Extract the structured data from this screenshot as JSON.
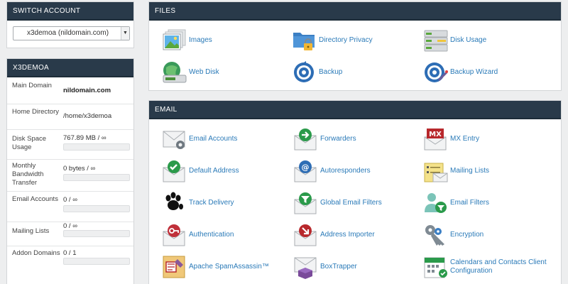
{
  "switch_account": {
    "title": "SWITCH ACCOUNT",
    "selected": "x3demoa (nildomain.com)"
  },
  "account": {
    "title": "X3DEMOA",
    "stats": [
      {
        "label": "Main Domain",
        "value": "nildomain.com"
      },
      {
        "label": "Home Directory",
        "value": "/home/x3demoa"
      },
      {
        "label": "Disk Space Usage",
        "value": "767.89 MB / ∞",
        "usage": 0
      },
      {
        "label": "Monthly Bandwidth Transfer",
        "value": "0 bytes / ∞",
        "usage": 0
      },
      {
        "label": "Email Accounts",
        "value": "0 / ∞",
        "usage": 0
      },
      {
        "label": "Mailing Lists",
        "value": "0 / ∞",
        "usage": 0
      },
      {
        "label": "Addon Domains",
        "value": "0 / 1",
        "usage": 0
      }
    ]
  },
  "files": {
    "title": "FILES",
    "items": [
      {
        "label": "Images",
        "icon": "images-icon"
      },
      {
        "label": "Directory Privacy",
        "icon": "folder-lock-icon"
      },
      {
        "label": "Disk Usage",
        "icon": "disk-usage-icon"
      },
      {
        "label": "Web Disk",
        "icon": "web-disk-icon"
      },
      {
        "label": "Backup",
        "icon": "backup-icon"
      },
      {
        "label": "Backup Wizard",
        "icon": "backup-wizard-icon"
      }
    ]
  },
  "email": {
    "title": "EMAIL",
    "items": [
      {
        "label": "Email Accounts",
        "icon": "email-accounts-icon"
      },
      {
        "label": "Forwarders",
        "icon": "forwarders-icon"
      },
      {
        "label": "MX Entry",
        "icon": "mx-entry-icon"
      },
      {
        "label": "Default Address",
        "icon": "default-address-icon"
      },
      {
        "label": "Autoresponders",
        "icon": "autoresponders-icon"
      },
      {
        "label": "Mailing Lists",
        "icon": "mailing-lists-icon"
      },
      {
        "label": "Track Delivery",
        "icon": "track-delivery-icon"
      },
      {
        "label": "Global Email Filters",
        "icon": "global-filters-icon"
      },
      {
        "label": "Email Filters",
        "icon": "email-filters-icon"
      },
      {
        "label": "Authentication",
        "icon": "authentication-icon"
      },
      {
        "label": "Address Importer",
        "icon": "address-importer-icon"
      },
      {
        "label": "Encryption",
        "icon": "encryption-icon"
      },
      {
        "label": "Apache SpamAssassin™",
        "icon": "spamassassin-icon"
      },
      {
        "label": "BoxTrapper",
        "icon": "boxtrapper-icon"
      },
      {
        "label": "Calendars and Contacts Client Configuration",
        "icon": "calendars-icon"
      }
    ]
  },
  "colors": {
    "header_bg": "#293a4a",
    "link": "#2a7ab8",
    "background": "#edeeef"
  }
}
